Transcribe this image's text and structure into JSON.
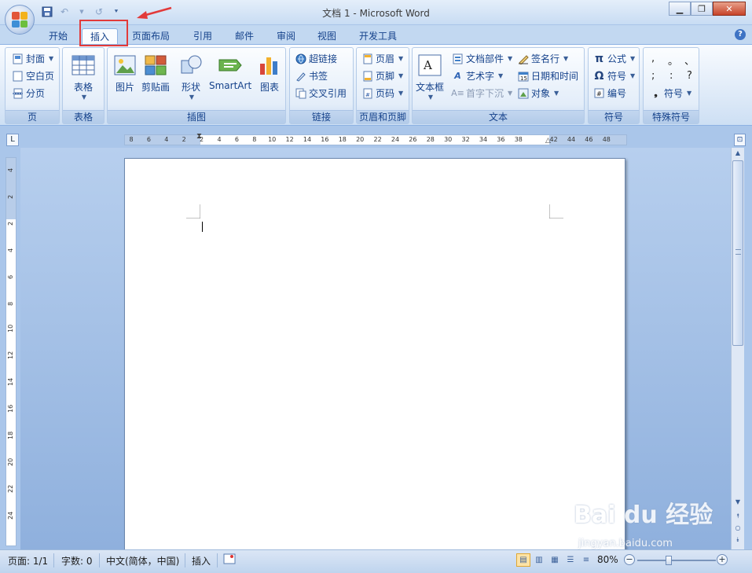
{
  "window": {
    "title": "文档 1 - Microsoft Word"
  },
  "tabs": [
    "开始",
    "插入",
    "页面布局",
    "引用",
    "邮件",
    "审阅",
    "视图",
    "开发工具"
  ],
  "active_tab": "插入",
  "ribbon": {
    "page_group": {
      "label": "页",
      "items": [
        "封面",
        "空白页",
        "分页"
      ]
    },
    "table_group": {
      "label": "表格",
      "button": "表格"
    },
    "illustrations_group": {
      "label": "插图",
      "buttons": [
        "图片",
        "剪贴画",
        "形状",
        "SmartArt",
        "图表"
      ]
    },
    "links_group": {
      "label": "链接",
      "items": [
        "超链接",
        "书签",
        "交叉引用"
      ]
    },
    "header_footer_group": {
      "label": "页眉和页脚",
      "items": [
        "页眉",
        "页脚",
        "页码"
      ]
    },
    "text_group": {
      "label": "文本",
      "textbox": "文本框",
      "items": [
        "文档部件",
        "艺术字",
        "首字下沉",
        "签名行",
        "日期和时间",
        "对象"
      ]
    },
    "symbols_group": {
      "label": "符号",
      "items": [
        "公式",
        "符号",
        "编号"
      ]
    },
    "special_group": {
      "label": "特殊符号",
      "symbols": [
        ",",
        "。",
        "、",
        ";",
        ":",
        "?"
      ],
      "button": "符号"
    }
  },
  "ruler": {
    "h_ticks": [
      "8",
      "6",
      "4",
      "2",
      "2",
      "4",
      "6",
      "8",
      "10",
      "12",
      "14",
      "16",
      "18",
      "20",
      "22",
      "24",
      "26",
      "28",
      "30",
      "32",
      "34",
      "36",
      "38",
      "42",
      "44",
      "46",
      "48"
    ],
    "v_ticks": [
      "4",
      "2",
      "2",
      "4",
      "6",
      "8",
      "10",
      "12",
      "14",
      "16",
      "18",
      "20",
      "22",
      "24"
    ]
  },
  "statusbar": {
    "page": "页面: 1/1",
    "words": "字数: 0",
    "language": "中文(简体，中国)",
    "mode": "插入",
    "zoom": "80%"
  },
  "watermark": {
    "text": "Bai du 经验",
    "url": "jingyan.baidu.com"
  }
}
